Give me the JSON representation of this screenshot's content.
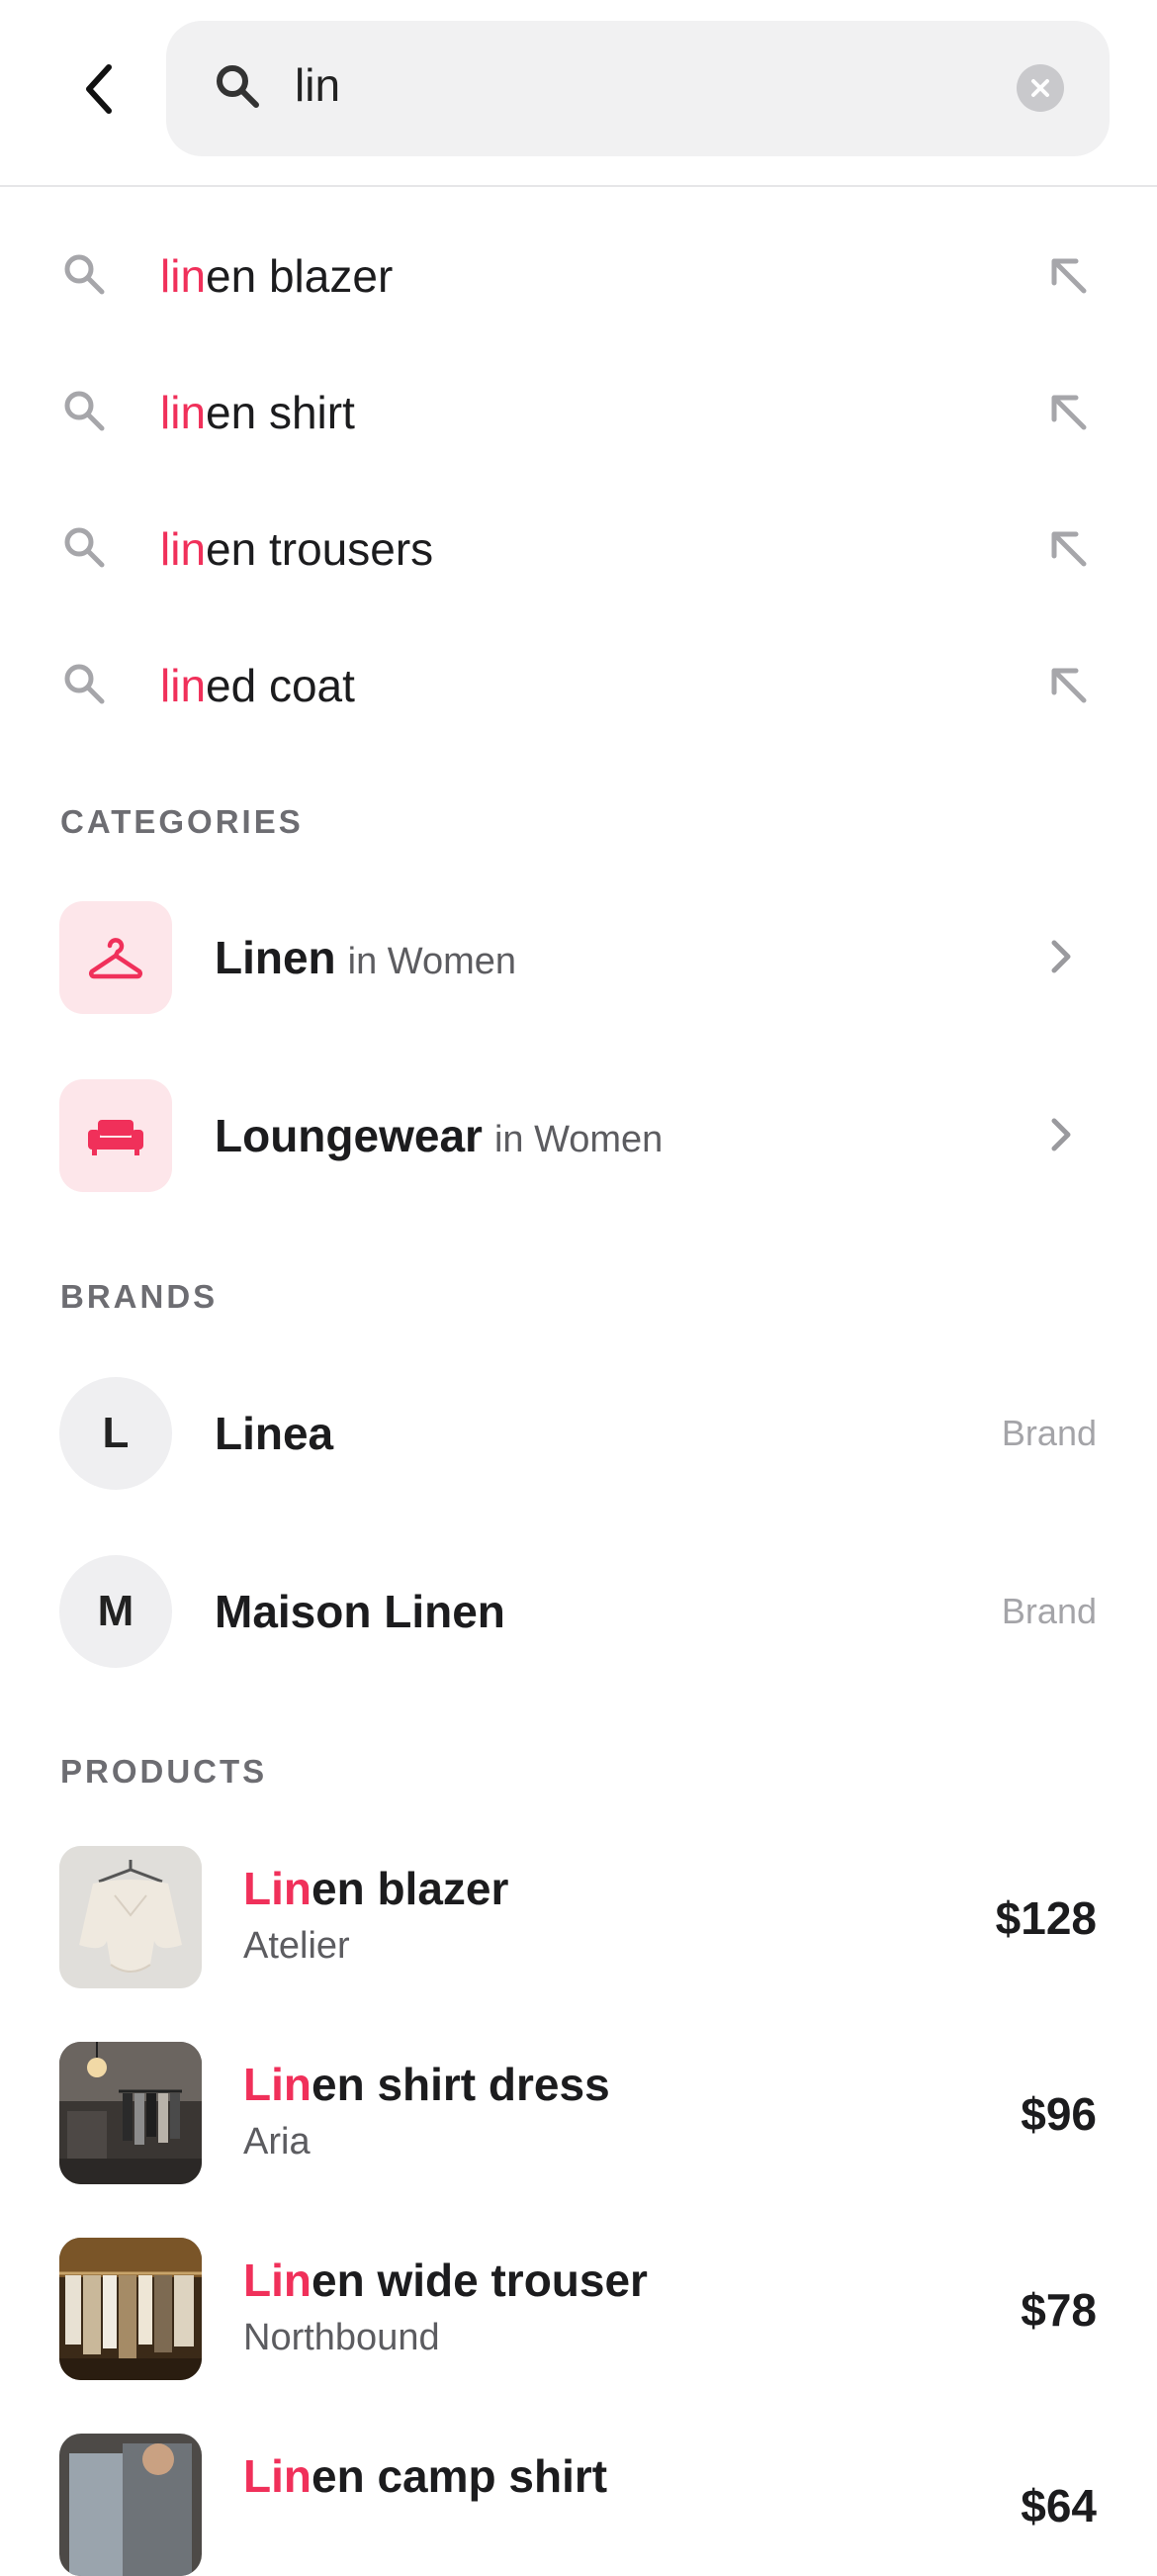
{
  "search": {
    "query": "lin"
  },
  "suggestions": [
    {
      "match": "lin",
      "rest": "en blazer"
    },
    {
      "match": "lin",
      "rest": "en shirt"
    },
    {
      "match": "lin",
      "rest": "en trousers"
    },
    {
      "match": "lin",
      "rest": "ed coat"
    }
  ],
  "categories": {
    "heading": "CATEGORIES",
    "items": [
      {
        "name": "Linen",
        "context": "in Women",
        "icon": "hanger-icon"
      },
      {
        "name": "Loungewear",
        "context": "in Women",
        "icon": "sofa-icon"
      }
    ]
  },
  "brands": {
    "heading": "BRANDS",
    "items": [
      {
        "initial": "L",
        "name": "Linea",
        "type": "Brand"
      },
      {
        "initial": "M",
        "name": "Maison Linen",
        "type": "Brand"
      }
    ]
  },
  "products": {
    "heading": "PRODUCTS",
    "items": [
      {
        "match": "Lin",
        "rest": "en blazer",
        "brand": "Atelier",
        "price": "$128"
      },
      {
        "match": "Lin",
        "rest": "en shirt dress",
        "brand": "Aria",
        "price": "$96"
      },
      {
        "match": "Lin",
        "rest": "en wide trouser",
        "brand": "Northbound",
        "price": "$78"
      },
      {
        "match": "Lin",
        "rest": "en camp shirt",
        "brand": "",
        "price": "$64"
      }
    ]
  },
  "colors": {
    "accent": "#f0305a",
    "accent_soft": "#fde6ea"
  }
}
